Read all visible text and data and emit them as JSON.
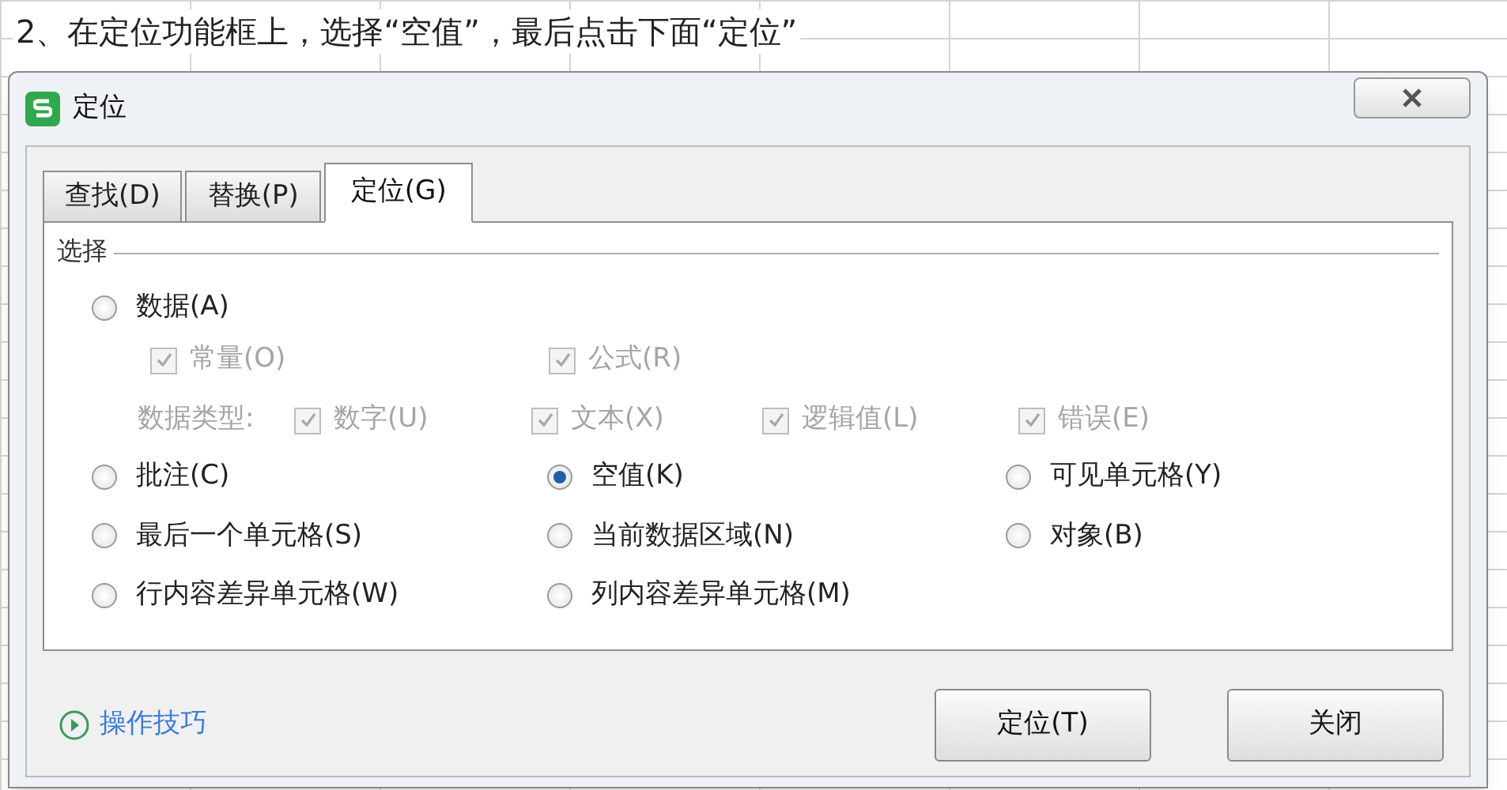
{
  "instruction": "2、在定位功能框上，选择“空值”，最后点击下面“定位”",
  "dialog": {
    "title": "定位",
    "tabs": [
      {
        "label": "查找(D)",
        "selected": false
      },
      {
        "label": "替换(P)",
        "selected": false
      },
      {
        "label": "定位(G)",
        "selected": true
      }
    ],
    "group_title": "选择",
    "data_radio": {
      "label": "数据(A)",
      "selected": false
    },
    "data_checks": [
      {
        "label": "常量(O)",
        "checked": true,
        "disabled": true
      },
      {
        "label": "公式(R)",
        "checked": true,
        "disabled": true
      }
    ],
    "type_label": "数据类型:",
    "type_checks": [
      {
        "label": "数字(U)",
        "checked": true,
        "disabled": true
      },
      {
        "label": "文本(X)",
        "checked": true,
        "disabled": true
      },
      {
        "label": "逻辑值(L)",
        "checked": true,
        "disabled": true
      },
      {
        "label": "错误(E)",
        "checked": true,
        "disabled": true
      }
    ],
    "options": [
      {
        "label": "批注(C)",
        "selected": false
      },
      {
        "label": "空值(K)",
        "selected": true
      },
      {
        "label": "可见单元格(Y)",
        "selected": false
      },
      {
        "label": "最后一个单元格(S)",
        "selected": false
      },
      {
        "label": "当前数据区域(N)",
        "selected": false
      },
      {
        "label": "对象(B)",
        "selected": false
      },
      {
        "label": "行内容差异单元格(W)",
        "selected": false
      },
      {
        "label": "列内容差异单元格(M)",
        "selected": false
      }
    ],
    "help_link": "操作技巧",
    "buttons": [
      "定位(T)",
      "关闭"
    ]
  }
}
